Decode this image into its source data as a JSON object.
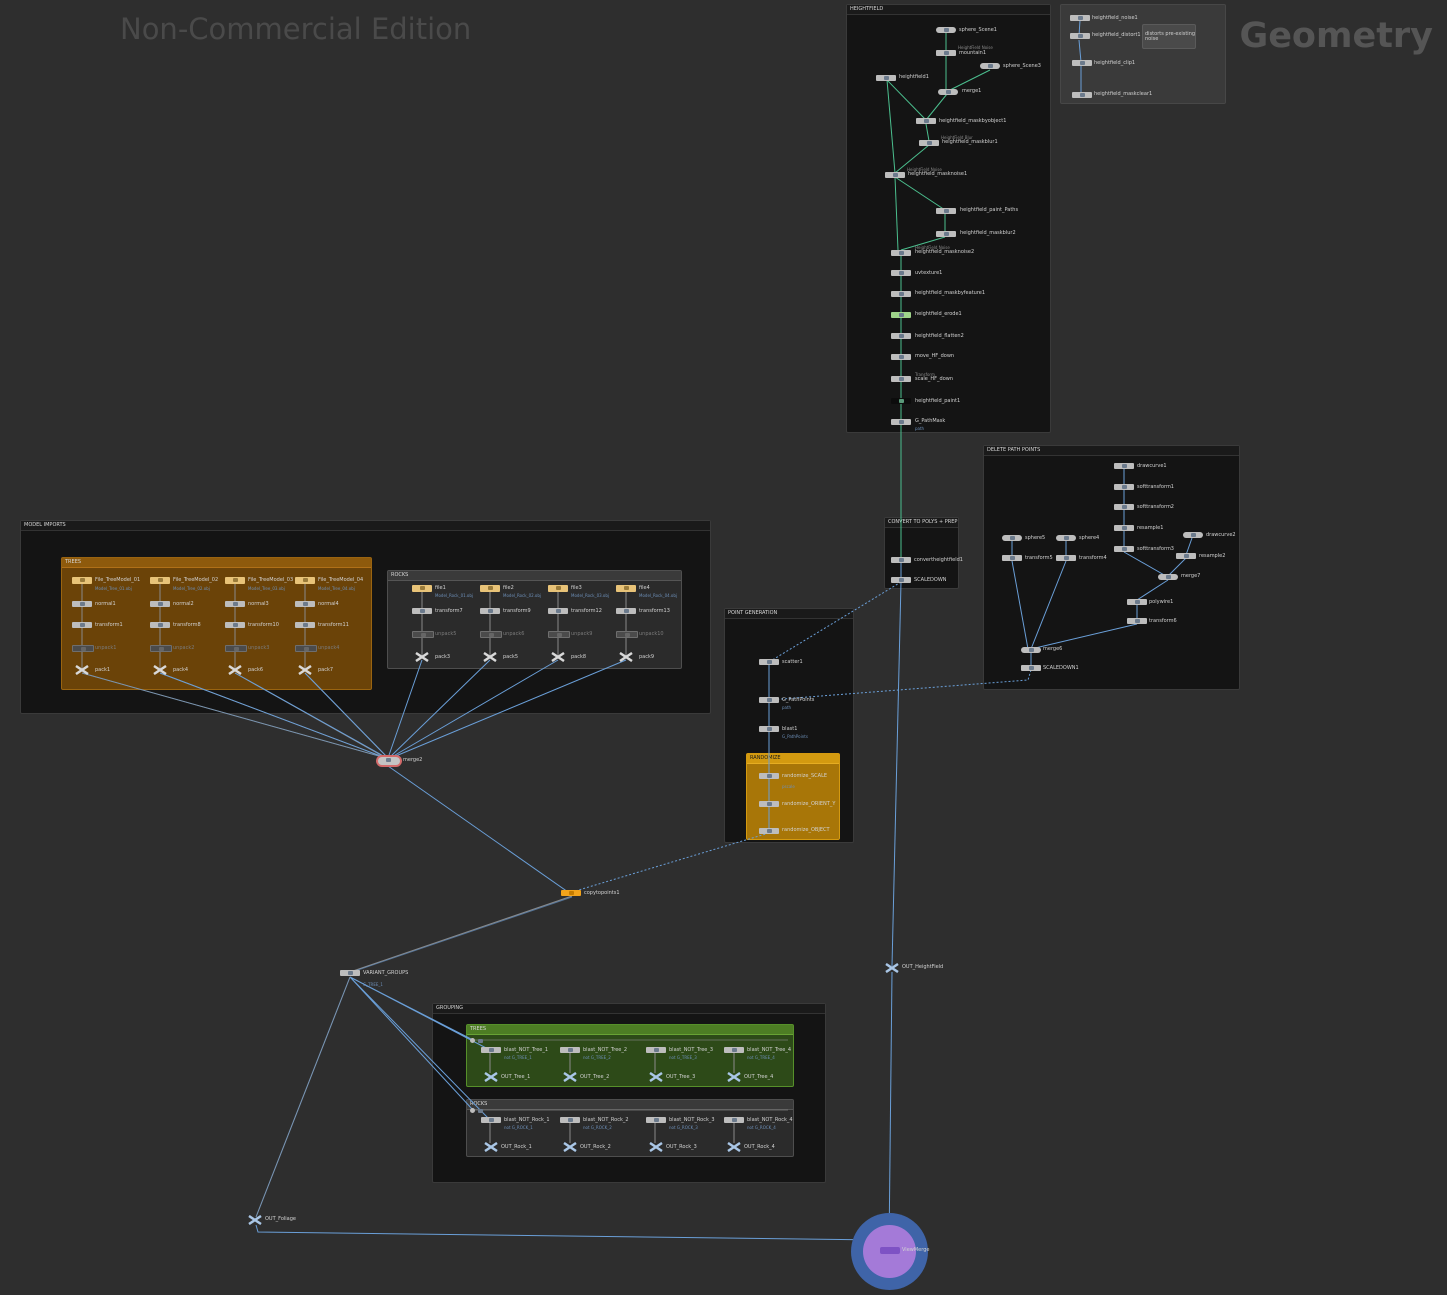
{
  "watermark": "Non-Commercial Edition",
  "context_label": "Geometry",
  "colors": {
    "wire_blue": "#6a9fd8",
    "wire_green": "#4bbf8e",
    "wire_grey": "#8a8a8a",
    "box_orange": "#6b4308",
    "box_green": "#2d4a18",
    "box_yellow": "#a87608",
    "copy_node": "#f2a31b",
    "viewmerge_ring": "#3f64a8",
    "viewmerge_fill": "#a47ad8"
  },
  "boxes": {
    "heightfield": "HEIGHTFIELD",
    "model_imports": "MODEL IMPORTS",
    "trees": "TREES",
    "rocks": "ROCKS",
    "convert": "CONVERT TO POLYS + PREP",
    "delete_path": "DELETE PATH POINTS",
    "point_gen": "POINT GENERATION",
    "randomize": "RANDOMIZE",
    "grouping": "GROUPING",
    "group_trees": "TREES",
    "group_rocks": "ROCKS"
  },
  "sticky": {
    "n1": "heightfield_noise1",
    "n2": "heightfield_distort1",
    "n3": "heightfield_clip1",
    "n4": "heightfield_maskclear1",
    "note": "distorts pre-existing\nnoise"
  },
  "heightfield": {
    "sphere_scene1": "sphere_Scene1",
    "mountain1": "mountain1",
    "mountain1_type": "HeightField Noise",
    "sphere_scene3": "sphere_Scene3",
    "heightfield1": "heightfield1",
    "merge1": "merge1",
    "maskbyobject1": "heightfield_maskbyobject1",
    "maskblur1": "heightfield_maskblur1",
    "maskblur1_type": "HeightField Blur",
    "masknoise1": "heightfield_masknoise1",
    "masknoise1_type": "HeightField Noise",
    "paint_paths": "heightfield_paint_Paths",
    "maskblur2": "heightfield_maskblur2",
    "masknoise2": "heightfield_masknoise2",
    "masknoise2_type": "HeightField Noise",
    "uvtexture1": "uvtexture1",
    "maskbyfeature1": "heightfield_maskbyfeature1",
    "erode1": "heightfield_erode1",
    "flatten2": "heightfield_flatten2",
    "move_hf_down": "move_HF_down",
    "scale_hf_down": "scale_HF_down",
    "scale_hf_down_type": "Transform",
    "paint1": "heightfield_paint1",
    "g_pathmask": "G_PathMask",
    "g_pathmask_sub": "path"
  },
  "convert": {
    "convertheightfield1": "convertheightfield1",
    "scaledown": "SCALEDOWN"
  },
  "delete_path": {
    "drawcurve1": "drawcurve1",
    "softtransform1": "softtransform1",
    "softtransform2": "softtransform2",
    "resample1": "resample1",
    "softtransform3": "softtransform3",
    "drawcurve2": "drawcurve2",
    "resample2": "resample2",
    "merge7": "merge7",
    "sphere5": "sphere5",
    "sphere4": "sphere4",
    "transform5": "transform5",
    "transform4": "transform4",
    "polywire1": "polywire1",
    "transform6": "transform6",
    "merge6": "merge6",
    "scaledown1": "SCALEDOWN1"
  },
  "point_gen": {
    "scatter1": "scatter1",
    "g_pathpoints": "G_PathPoints",
    "g_pathpoints_sub": "path",
    "blast1": "blast1",
    "blast1_sub": "G_PathPoints",
    "randomize_scale": "randomize_SCALE",
    "randomize_scale_sub": "pscale",
    "randomize_orient": "randomize_ORIENT_Y",
    "randomize_object": "randomize_OBJECT"
  },
  "tree_cols": [
    {
      "file": "File_TreeModel_01",
      "file_sub": "Model_Tree_01.obj",
      "normal": "normal1",
      "transform": "transform1",
      "unpack": "unpack1",
      "pack": "pack1"
    },
    {
      "file": "File_TreeModel_02",
      "file_sub": "Model_Tree_02.obj",
      "normal": "normal2",
      "transform": "transform8",
      "unpack": "unpack2",
      "pack": "pack4"
    },
    {
      "file": "File_TreeModel_03",
      "file_sub": "Model_Tree_03.obj",
      "normal": "normal3",
      "transform": "transform10",
      "unpack": "unpack3",
      "pack": "pack6"
    },
    {
      "file": "File_TreeModel_04",
      "file_sub": "Model_Tree_04.obj",
      "normal": "normal4",
      "transform": "transform11",
      "unpack": "unpack4",
      "pack": "pack7"
    }
  ],
  "rock_cols": [
    {
      "file": "file1",
      "file_sub": "Model_Rock_01.obj",
      "transform": "transform7",
      "unpack": "unpack5",
      "pack": "pack3"
    },
    {
      "file": "file2",
      "file_sub": "Model_Rock_02.obj",
      "transform": "transform9",
      "unpack": "unpack6",
      "pack": "pack5"
    },
    {
      "file": "file3",
      "file_sub": "Model_Rock_03.obj",
      "transform": "transform12",
      "unpack": "unpack9",
      "pack": "pack8"
    },
    {
      "file": "file4",
      "file_sub": "Model_Rock_04.obj",
      "transform": "transform13",
      "unpack": "unpack10",
      "pack": "pack9"
    }
  ],
  "main": {
    "merge2": "merge2",
    "copytopoints1": "copytopoints1",
    "variant_groups": "VARIANT_GROUPS",
    "variant_groups_sub": "G_TREE_1",
    "out_heightfield": "OUT_HeightField",
    "out_foliage": "OUT_Foliage",
    "viewmerge": "ViewMerge"
  },
  "group_trees": [
    {
      "blast": "blast_NOT_Tree_1",
      "blast_sub": "not G_TREE_1",
      "out": "OUT_Tree_1"
    },
    {
      "blast": "blast_NOT_Tree_2",
      "blast_sub": "not G_TREE_2",
      "out": "OUT_Tree_2"
    },
    {
      "blast": "blast_NOT_Tree_3",
      "blast_sub": "not G_TREE_3",
      "out": "OUT_Tree_3"
    },
    {
      "blast": "blast_NOT_Tree_4",
      "blast_sub": "not G_TREE_4",
      "out": "OUT_Tree_4"
    }
  ],
  "group_rocks": [
    {
      "blast": "blast_NOT_Rock_1",
      "blast_sub": "not G_ROCK_1",
      "out": "OUT_Rock_1"
    },
    {
      "blast": "blast_NOT_Rock_2",
      "blast_sub": "not G_ROCK_2",
      "out": "OUT_Rock_2"
    },
    {
      "blast": "blast_NOT_Rock_3",
      "blast_sub": "not G_ROCK_3",
      "out": "OUT_Rock_3"
    },
    {
      "blast": "blast_NOT_Rock_4",
      "blast_sub": "not G_ROCK_4",
      "out": "OUT_Rock_4"
    }
  ]
}
